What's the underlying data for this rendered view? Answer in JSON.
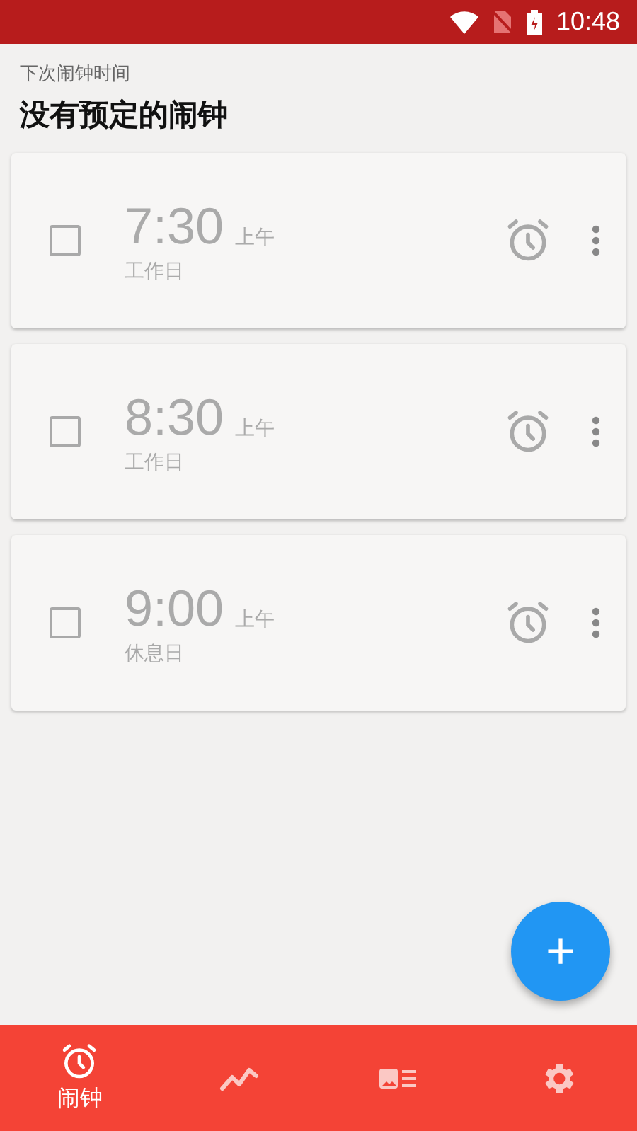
{
  "status_bar": {
    "time": "10:48"
  },
  "header": {
    "subtitle": "下次闹钟时间",
    "title": "没有预定的闹钟"
  },
  "alarms": [
    {
      "time": "7:30",
      "period": "上午",
      "repeat": "工作日",
      "checked": false
    },
    {
      "time": "8:30",
      "period": "上午",
      "repeat": "工作日",
      "checked": false
    },
    {
      "time": "9:00",
      "period": "上午",
      "repeat": "休息日",
      "checked": false
    }
  ],
  "fab": {
    "label": "+"
  },
  "bottom_nav": [
    {
      "kind": "alarm",
      "label": "闹钟",
      "selected": true
    },
    {
      "kind": "stats",
      "selected": false
    },
    {
      "kind": "cards",
      "selected": false
    },
    {
      "kind": "settings",
      "selected": false
    }
  ]
}
